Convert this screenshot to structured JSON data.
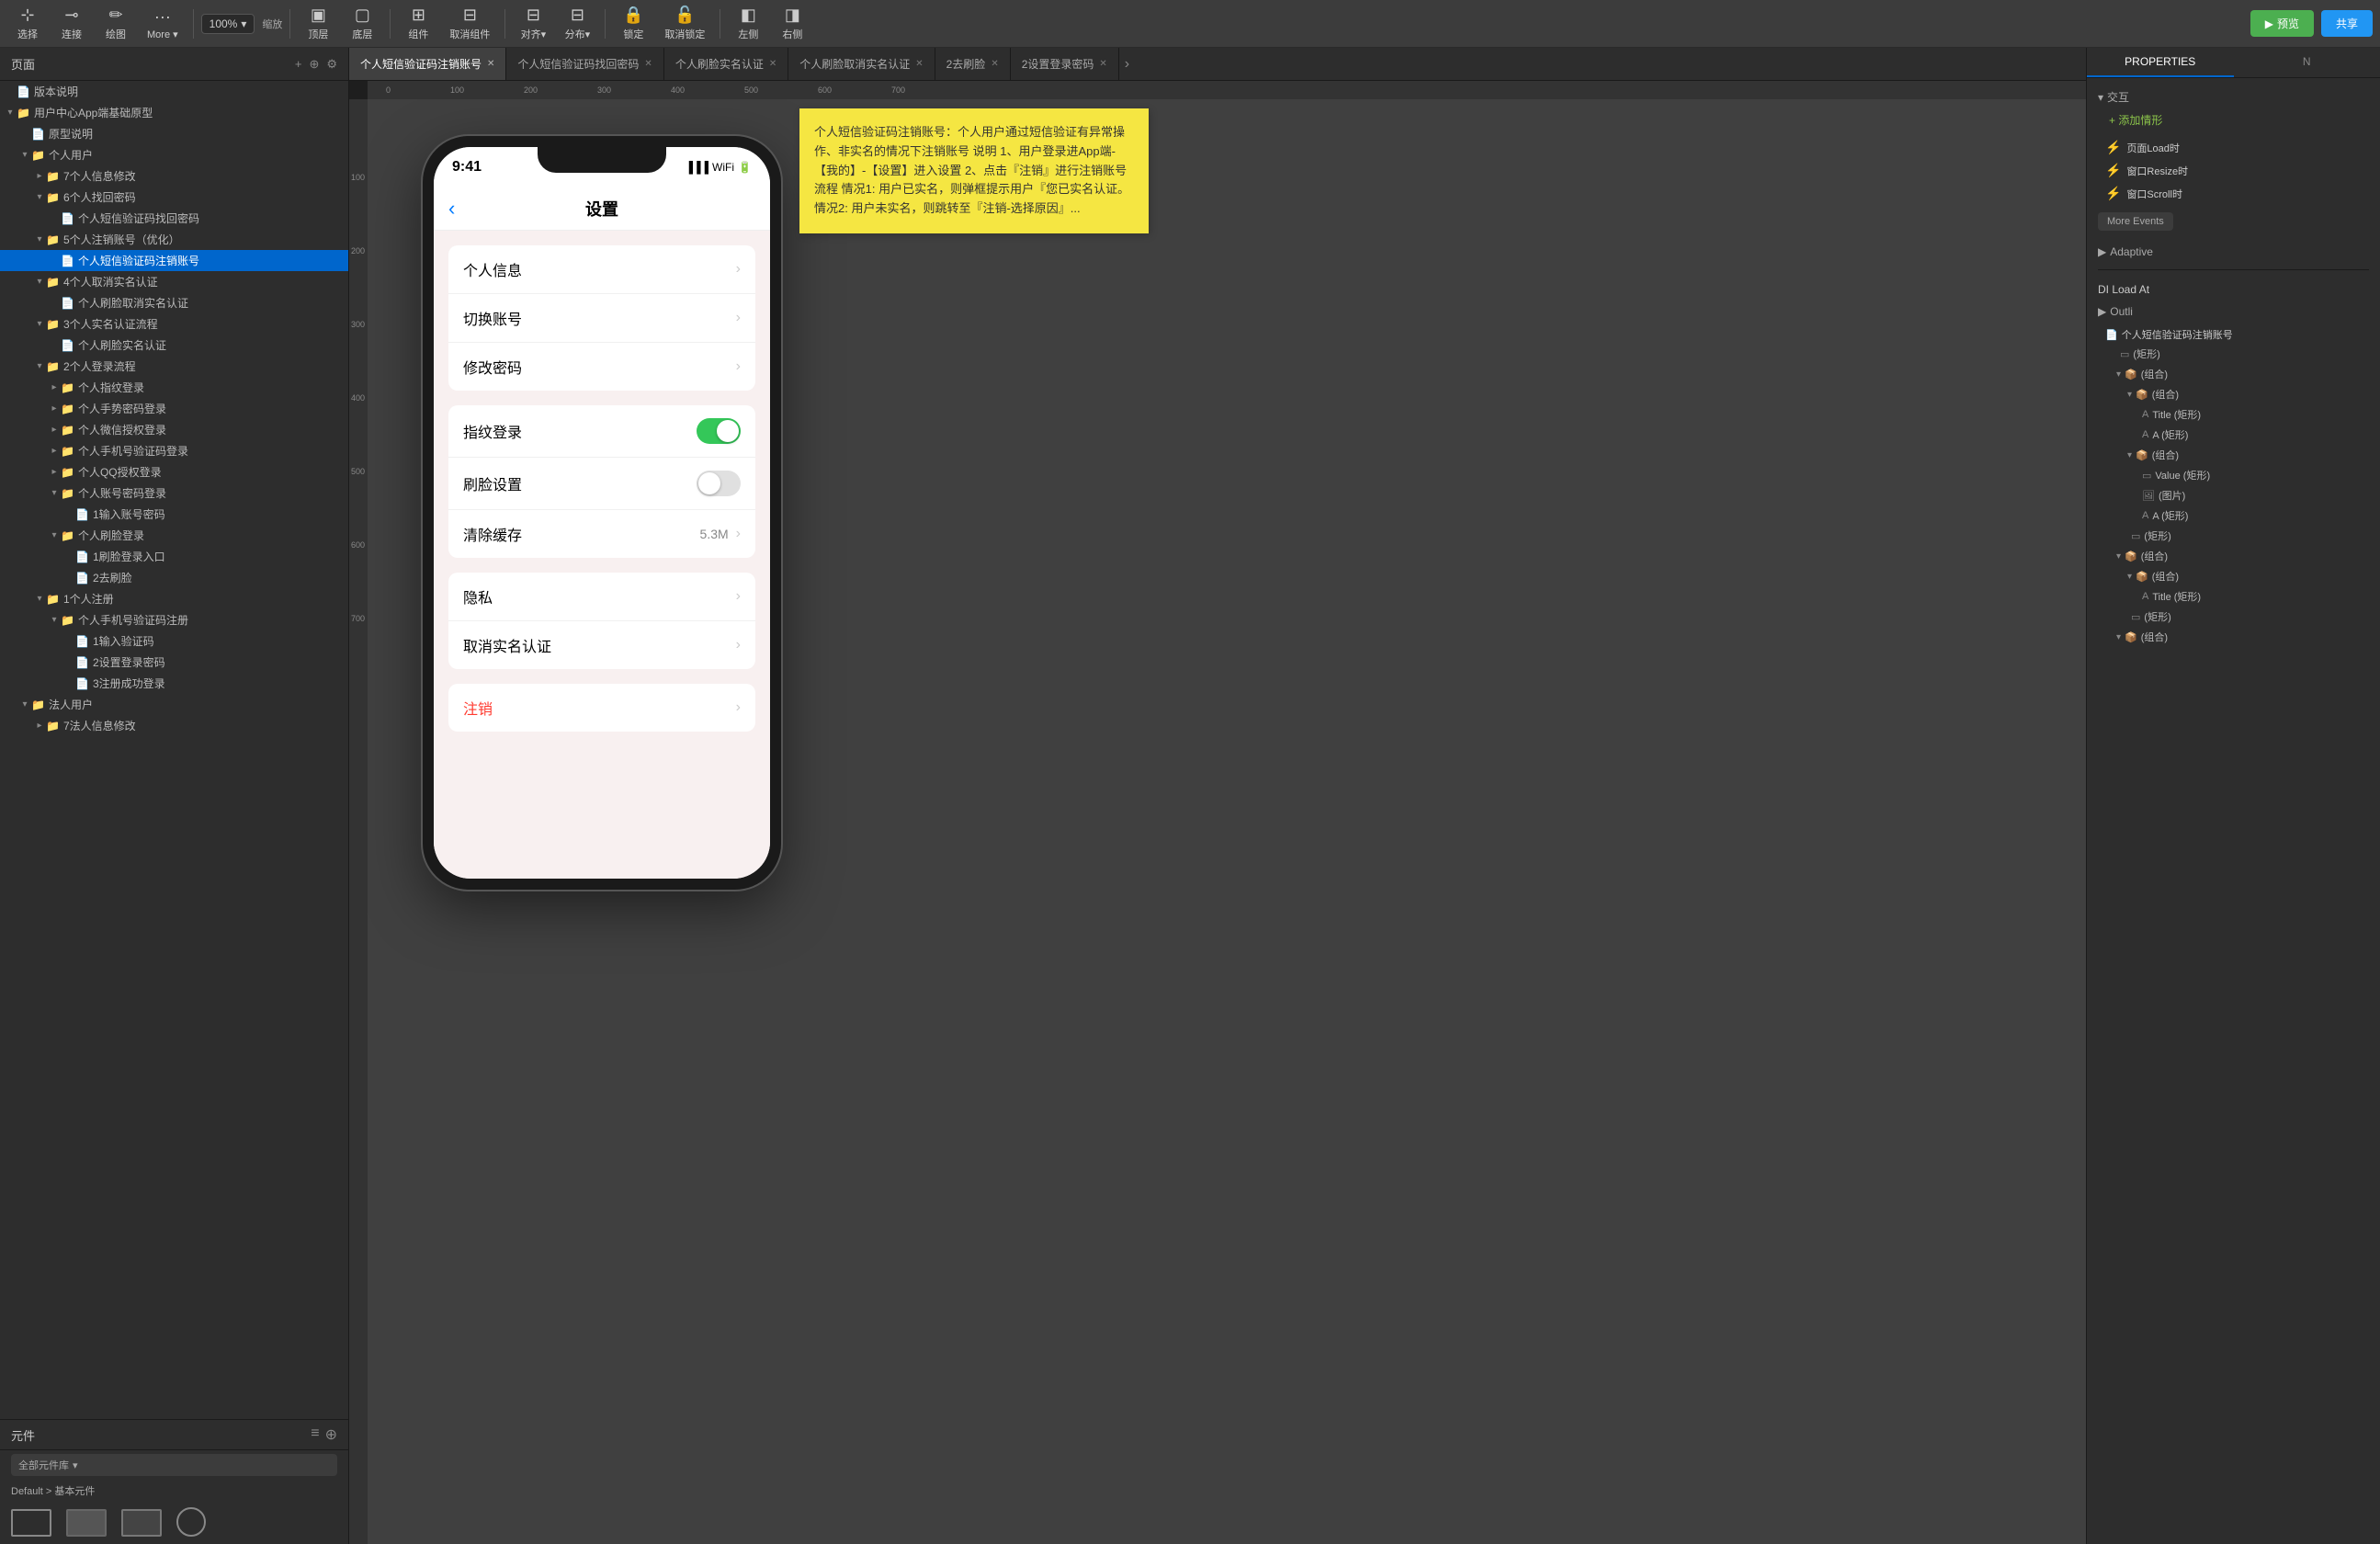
{
  "toolbar": {
    "tools": [
      {
        "id": "select",
        "label": "选择",
        "icon": "⊹"
      },
      {
        "id": "connect",
        "label": "连接",
        "icon": "⊸"
      },
      {
        "id": "draw",
        "label": "绘图",
        "icon": "✏"
      },
      {
        "id": "more",
        "label": "More ▾",
        "icon": "···"
      }
    ],
    "zoom": "100%",
    "zoom_label": "缩放",
    "layer_top": "顶层",
    "layer_bottom": "底层",
    "group": "组件",
    "ungroup": "取消组件",
    "align": "对齐▾",
    "distribute": "分布▾",
    "lock": "锁定",
    "unlock": "取消锁定",
    "left_side": "左侧",
    "right_side": "右侧",
    "preview": "预览",
    "share": "共享"
  },
  "left_panel": {
    "header": "页面",
    "tree": [
      {
        "id": "root1",
        "label": "版本说明",
        "level": 0,
        "type": "file",
        "expanded": false
      },
      {
        "id": "root2",
        "label": "用户中心App端基础原型",
        "level": 0,
        "type": "folder",
        "expanded": true
      },
      {
        "id": "n1",
        "label": "原型说明",
        "level": 1,
        "type": "file",
        "expanded": false
      },
      {
        "id": "n2",
        "label": "个人用户",
        "level": 1,
        "type": "folder",
        "expanded": true
      },
      {
        "id": "n3",
        "label": "7个人信息修改",
        "level": 2,
        "type": "folder",
        "expanded": false
      },
      {
        "id": "n4",
        "label": "6个人找回密码",
        "level": 2,
        "type": "folder",
        "expanded": true
      },
      {
        "id": "n5",
        "label": "个人短信验证码找回密码",
        "level": 3,
        "type": "file",
        "expanded": false
      },
      {
        "id": "n6",
        "label": "5个人注销账号（优化）",
        "level": 2,
        "type": "folder",
        "expanded": true
      },
      {
        "id": "n7",
        "label": "个人短信验证码注销账号",
        "level": 3,
        "type": "file",
        "selected": true,
        "expanded": false
      },
      {
        "id": "n8",
        "label": "4个人取消实名认证",
        "level": 2,
        "type": "folder",
        "expanded": true
      },
      {
        "id": "n9",
        "label": "个人刷脸取消实名认证",
        "level": 3,
        "type": "file",
        "expanded": false
      },
      {
        "id": "n10",
        "label": "3个人实名认证流程",
        "level": 2,
        "type": "folder",
        "expanded": true
      },
      {
        "id": "n11",
        "label": "个人刷脸实名认证",
        "level": 3,
        "type": "file",
        "expanded": false
      },
      {
        "id": "n12",
        "label": "2个人登录流程",
        "level": 2,
        "type": "folder",
        "expanded": true
      },
      {
        "id": "n13",
        "label": "个人指纹登录",
        "level": 3,
        "type": "folder",
        "expanded": false
      },
      {
        "id": "n14",
        "label": "个人手势密码登录",
        "level": 3,
        "type": "folder",
        "expanded": false
      },
      {
        "id": "n15",
        "label": "个人微信授权登录",
        "level": 3,
        "type": "folder",
        "expanded": false
      },
      {
        "id": "n16",
        "label": "个人手机号验证码登录",
        "level": 3,
        "type": "folder",
        "expanded": false
      },
      {
        "id": "n17",
        "label": "个人QQ授权登录",
        "level": 3,
        "type": "folder",
        "expanded": false
      },
      {
        "id": "n18",
        "label": "个人账号密码登录",
        "level": 3,
        "type": "folder",
        "expanded": true
      },
      {
        "id": "n19",
        "label": "1输入账号密码",
        "level": 4,
        "type": "file",
        "expanded": false
      },
      {
        "id": "n20",
        "label": "个人刷脸登录",
        "level": 3,
        "type": "folder",
        "expanded": true
      },
      {
        "id": "n21",
        "label": "1刷脸登录入口",
        "level": 4,
        "type": "file",
        "expanded": false
      },
      {
        "id": "n22",
        "label": "2去刷脸",
        "level": 4,
        "type": "file",
        "expanded": false
      },
      {
        "id": "n23",
        "label": "1个人注册",
        "level": 2,
        "type": "folder",
        "expanded": true
      },
      {
        "id": "n24",
        "label": "个人手机号验证码注册",
        "level": 3,
        "type": "folder",
        "expanded": true
      },
      {
        "id": "n25",
        "label": "1输入验证码",
        "level": 4,
        "type": "file",
        "expanded": false
      },
      {
        "id": "n26",
        "label": "2设置登录密码",
        "level": 4,
        "type": "file",
        "expanded": false
      },
      {
        "id": "n27",
        "label": "3注册成功登录",
        "level": 4,
        "type": "file",
        "expanded": false
      },
      {
        "id": "n28",
        "label": "法人用户",
        "level": 1,
        "type": "folder",
        "expanded": true
      },
      {
        "id": "n29",
        "label": "7法人信息修改",
        "level": 2,
        "type": "folder",
        "expanded": false
      }
    ]
  },
  "tabs": [
    {
      "id": "t1",
      "label": "个人短信验证码注销账号",
      "active": true
    },
    {
      "id": "t2",
      "label": "个人短信验证码找回密码",
      "active": false
    },
    {
      "id": "t3",
      "label": "个人刷脸实名认证",
      "active": false
    },
    {
      "id": "t4",
      "label": "个人刷脸取消实名认证",
      "active": false
    },
    {
      "id": "t5",
      "label": "2去刷脸",
      "active": false
    },
    {
      "id": "t6",
      "label": "2设置登录密码",
      "active": false
    }
  ],
  "phone": {
    "time": "9:41",
    "nav_title": "设置",
    "back_icon": "‹",
    "settings_items": [
      {
        "id": "s1",
        "label": "个人信息",
        "type": "arrow"
      },
      {
        "id": "s2",
        "label": "切换账号",
        "type": "arrow"
      },
      {
        "id": "s3",
        "label": "修改密码",
        "type": "arrow"
      },
      {
        "id": "s4",
        "label": "指纹登录",
        "type": "toggle_on"
      },
      {
        "id": "s5",
        "label": "刷脸设置",
        "type": "toggle_off"
      },
      {
        "id": "s6",
        "label": "清除缓存",
        "type": "value",
        "value": "5.3M"
      },
      {
        "id": "s7",
        "label": "隐私",
        "type": "arrow"
      },
      {
        "id": "s8",
        "label": "取消实名认证",
        "type": "arrow"
      },
      {
        "id": "s9",
        "label": "注销",
        "type": "arrow",
        "red": true
      }
    ]
  },
  "sticky_note": {
    "text": "个人短信验证码注销账号：个人用户通过短信验证有异常操作、非实名的情况下注销账号\n说明\n1、用户登录进App端-【我的】-【设置】进入设置\n2、点击『注销』进行注销账号流程\n情况1: 用户已实名，则弹框提示用户『您已实名认证。\n情况2: 用户未实名，则跳转至『注销-选择原因』..."
  },
  "right_panel": {
    "tab_properties": "PROPERTIES",
    "tab_note": "N",
    "sections": {
      "interaction": {
        "title": "交互",
        "add_label": "+ 添加情形",
        "events": [
          {
            "label": "页面Load时"
          },
          {
            "label": "窗口Resize时"
          },
          {
            "label": "窗口Scroll时"
          }
        ],
        "more_events": "More Events"
      },
      "adaptive": {
        "title": "Adaptive"
      }
    },
    "di_load": "DI Load At",
    "outline": {
      "title": "Outli",
      "page_label": "个人短信验证码注销账号",
      "items": [
        {
          "label": "(矩形)",
          "level": 1,
          "type": "shape"
        },
        {
          "label": "(组合)",
          "level": 1,
          "type": "group",
          "expanded": true
        },
        {
          "label": "(组合)",
          "level": 2,
          "type": "group",
          "expanded": true
        },
        {
          "label": "Title (矩形)",
          "level": 3,
          "type": "text"
        },
        {
          "label": "A (矩形)",
          "level": 3,
          "type": "text"
        },
        {
          "label": "(组合)",
          "level": 2,
          "type": "group",
          "expanded": true
        },
        {
          "label": "Value (矩形)",
          "level": 3,
          "type": "shape"
        },
        {
          "label": "(图片)",
          "level": 3,
          "type": "image"
        },
        {
          "label": "A (矩形)",
          "level": 3,
          "type": "text"
        },
        {
          "label": "(矩形)",
          "level": 2,
          "type": "shape"
        },
        {
          "label": "(组合)",
          "level": 1,
          "type": "group",
          "expanded": true
        },
        {
          "label": "(组合)",
          "level": 2,
          "type": "group",
          "expanded": true
        },
        {
          "label": "Title (矩形)",
          "level": 3,
          "type": "text"
        },
        {
          "label": "(矩形)",
          "level": 2,
          "type": "shape"
        },
        {
          "label": "(组合)",
          "level": 1,
          "type": "group",
          "expanded": true
        }
      ]
    }
  },
  "bottom_panel": {
    "header": "元件",
    "filter_label": "全部元件库",
    "default_section": "Default > 基本元件",
    "components": [
      {
        "id": "c1",
        "shape": "rect",
        "w": 40,
        "h": 30
      },
      {
        "id": "c2",
        "shape": "rect",
        "w": 40,
        "h": 30,
        "style": "dashed"
      },
      {
        "id": "c3",
        "shape": "rect",
        "w": 40,
        "h": 30,
        "style": "gray"
      },
      {
        "id": "c4",
        "shape": "circle",
        "w": 30,
        "h": 30
      }
    ]
  }
}
